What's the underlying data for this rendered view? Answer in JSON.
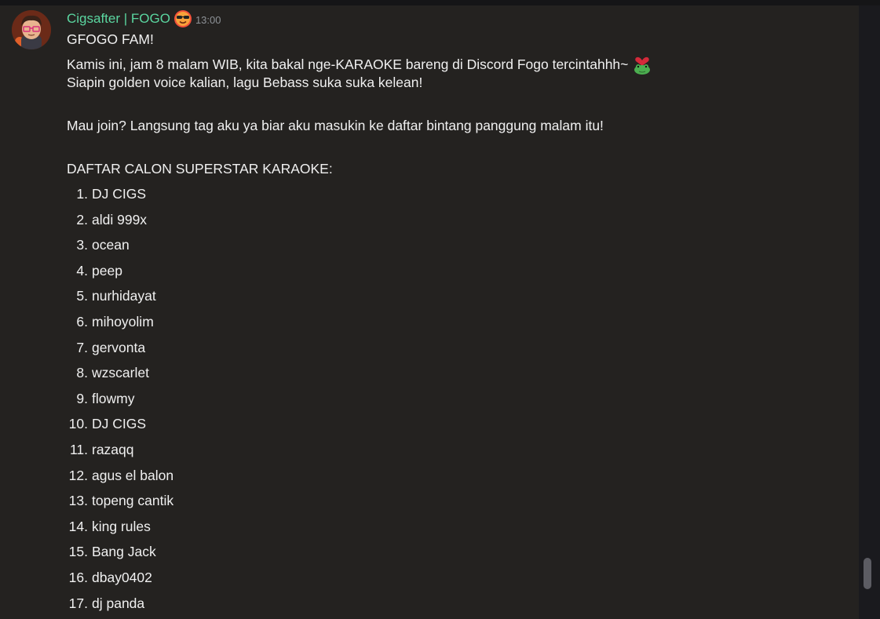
{
  "message": {
    "author": "Cigsafter | FOGO",
    "timestamp": "13:00",
    "lines": {
      "greeting": "GFOGO FAM!",
      "announcement": "Kamis ini, jam 8 malam WIB, kita bakal nge-KARAOKE bareng di Discord Fogo tercintahhh~",
      "prep": "Siapin golden voice kalian, lagu Bebass suka suka kelean!",
      "join": "Mau join? Langsung tag aku ya biar aku masukin ke daftar bintang panggung malam itu!",
      "list_title": "DAFTAR CALON SUPERSTAR KARAOKE:"
    },
    "list": [
      {
        "num": "1.",
        "name": "DJ CIGS"
      },
      {
        "num": "2.",
        "name": "aldi 999x"
      },
      {
        "num": "3.",
        "name": "ocean"
      },
      {
        "num": "4.",
        "name": "peep"
      },
      {
        "num": "5.",
        "name": "nurhidayat"
      },
      {
        "num": "6.",
        "name": "mihoyolim"
      },
      {
        "num": "7.",
        "name": "gervonta"
      },
      {
        "num": "8.",
        "name": "wzscarlet"
      },
      {
        "num": "9.",
        "name": "flowmy"
      },
      {
        "num": "10.",
        "name": "DJ CIGS"
      },
      {
        "num": "11.",
        "name": "razaqq"
      },
      {
        "num": "12.",
        "name": "agus el balon"
      },
      {
        "num": "13.",
        "name": "topeng cantik"
      },
      {
        "num": "14.",
        "name": "king rules"
      },
      {
        "num": "15.",
        "name": "Bang Jack"
      },
      {
        "num": "16.",
        "name": "dbay0402"
      },
      {
        "num": "17.",
        "name": "dj panda"
      }
    ]
  },
  "icons": {
    "avatar": "cartoon-avatar-icon",
    "role_emoji": "sunglasses-face-icon",
    "inline_emoji": "frog-heart-icon"
  },
  "colors": {
    "username": "#5bd6a0",
    "timestamp": "#8e9297",
    "background": "#242220",
    "text": "#f0f0f0"
  }
}
